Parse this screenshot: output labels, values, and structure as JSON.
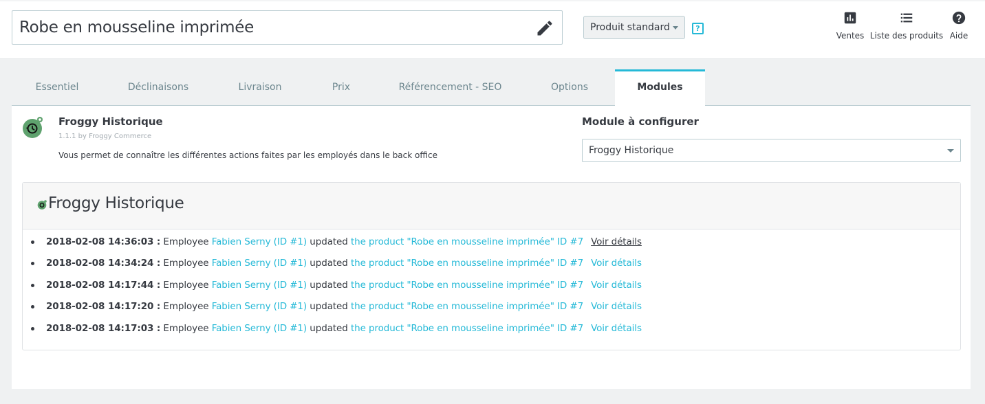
{
  "header": {
    "product_name": "Robe en mousseline imprimée",
    "product_type": "Produit standard",
    "help_badge": "?",
    "tools": [
      {
        "label": "Ventes",
        "icon": "bar-chart-icon"
      },
      {
        "label": "Liste des produits",
        "icon": "list-icon"
      },
      {
        "label": "Aide",
        "icon": "help-circle-icon"
      }
    ]
  },
  "tabs": [
    {
      "label": "Essentiel",
      "active": false
    },
    {
      "label": "Déclinaisons",
      "active": false
    },
    {
      "label": "Livraison",
      "active": false
    },
    {
      "label": "Prix",
      "active": false
    },
    {
      "label": "Référencement - SEO",
      "active": false
    },
    {
      "label": "Options",
      "active": false
    },
    {
      "label": "Modules",
      "active": true
    }
  ],
  "module": {
    "name": "Froggy Historique",
    "version": "1.1.1 by Froggy Commerce",
    "description": "Vous permet de connaître les différentes actions faites par les employés dans le back office",
    "config_label": "Module à configurer",
    "config_selected": "Froggy Historique"
  },
  "history": {
    "title": "Froggy Historique",
    "entries": [
      {
        "timestamp": "2018-02-08 14:36:03 :",
        "employee_prefix": "Employee",
        "employee": "Fabien Serny (ID #1)",
        "action": "updated",
        "target": "the product \"Robe en mousseline imprimée\" ID #7",
        "details": "Voir détails"
      },
      {
        "timestamp": "2018-02-08 14:34:24 :",
        "employee_prefix": "Employee",
        "employee": "Fabien Serny (ID #1)",
        "action": "updated",
        "target": "the product \"Robe en mousseline imprimée\" ID #7",
        "details": "Voir détails"
      },
      {
        "timestamp": "2018-02-08 14:17:44 :",
        "employee_prefix": "Employee",
        "employee": "Fabien Serny (ID #1)",
        "action": "updated",
        "target": "the product \"Robe en mousseline imprimée\" ID #7",
        "details": "Voir détails"
      },
      {
        "timestamp": "2018-02-08 14:17:20 :",
        "employee_prefix": "Employee",
        "employee": "Fabien Serny (ID #1)",
        "action": "updated",
        "target": "the product \"Robe en mousseline imprimée\" ID #7",
        "details": "Voir détails"
      },
      {
        "timestamp": "2018-02-08 14:17:03 :",
        "employee_prefix": "Employee",
        "employee": "Fabien Serny (ID #1)",
        "action": "updated",
        "target": "the product \"Robe en mousseline imprimée\" ID #7",
        "details": "Voir détails"
      }
    ]
  },
  "colors": {
    "accent": "#25b9d7",
    "text": "#363a41",
    "muted": "#6c868e",
    "background": "#eff1f2",
    "froggy_green": "#5fa26e"
  }
}
